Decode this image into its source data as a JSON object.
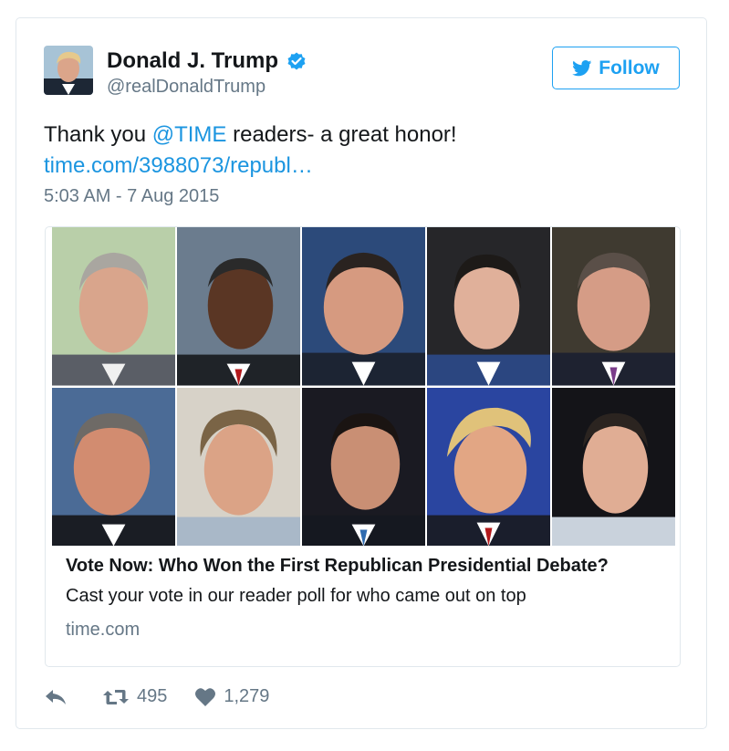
{
  "user": {
    "name": "Donald J. Trump",
    "handle": "@realDonaldTrump",
    "verified_icon": "verified-badge-icon",
    "follow_label": "Follow"
  },
  "tweet": {
    "text_before": "Thank you ",
    "mention": "@TIME",
    "text_after": " readers- a great honor!",
    "link": "time.com/3988073/republ…",
    "timestamp": "5:03 AM - 7 Aug 2015"
  },
  "card": {
    "title": "Vote Now: Who Won the First Republican Presidential Debate?",
    "description": "Cast your vote in our reader poll for who came out on top",
    "domain": "time.com"
  },
  "actions": {
    "reply_icon": "reply-icon",
    "retweet_icon": "retweet-icon",
    "retweet_count": "495",
    "like_icon": "heart-icon",
    "like_count": "1,279"
  },
  "colors": {
    "accent": "#1da1f2",
    "link": "#1b95e0",
    "muted": "#657786",
    "text": "#14171a",
    "border": "#e1e8ed"
  }
}
